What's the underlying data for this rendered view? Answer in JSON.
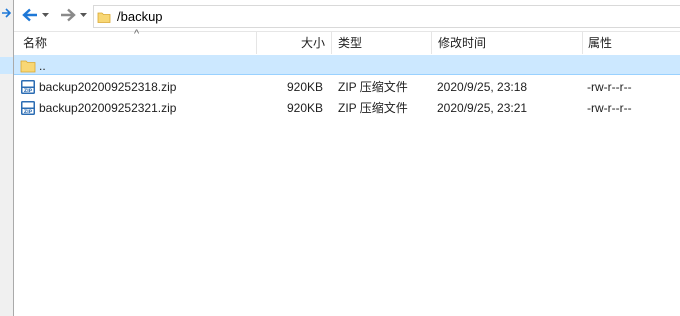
{
  "toolbar": {
    "back_icon": "arrow-left-icon",
    "forward_icon": "arrow-right-icon",
    "dropdown_icon": "chevron-down-icon",
    "path": "/backup",
    "colors": {
      "back_arrow": "#1e78d7",
      "forward_arrow": "#8a8a8a",
      "folder": "#f8d775"
    }
  },
  "header": {
    "name": "名称",
    "size": "大小",
    "type": "类型",
    "modified": "修改时间",
    "attributes": "属性",
    "sort_indicator": "^"
  },
  "files": [
    {
      "icon": "folder-icon",
      "name": "..",
      "size": "",
      "type": "",
      "modified": "",
      "attributes": "",
      "selected": true
    },
    {
      "icon": "zip-file-icon",
      "name": "backup202009252318.zip",
      "size": "920KB",
      "type": "ZIP 压缩文件",
      "modified": "2020/9/25, 23:18",
      "attributes": "-rw-r--r--",
      "selected": false
    },
    {
      "icon": "zip-file-icon",
      "name": "backup202009252321.zip",
      "size": "920KB",
      "type": "ZIP 压缩文件",
      "modified": "2020/9/25, 23:21",
      "attributes": "-rw-r--r--",
      "selected": false
    }
  ],
  "colors": {
    "selection_bg": "#cce8ff",
    "selection_border": "#99d1ff"
  }
}
